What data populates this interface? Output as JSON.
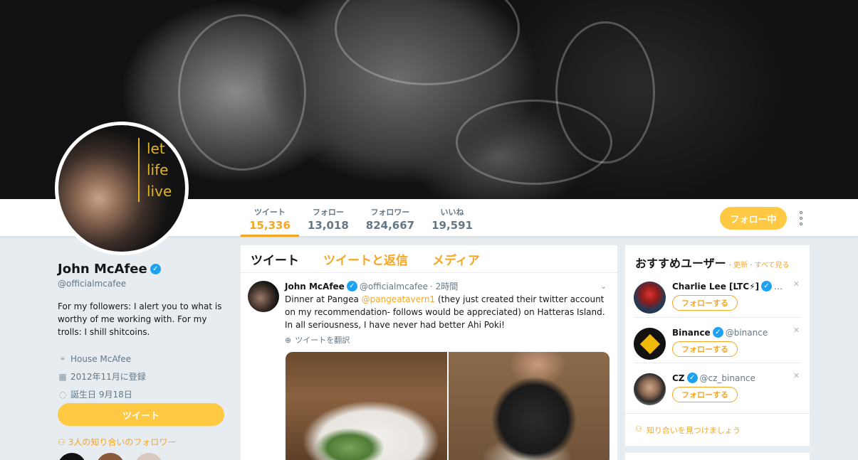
{
  "profile": {
    "name": "John McAfee",
    "handle": "@officialmcafee",
    "bio": "For my followers: I alert you to what is worthy of me working with. For my trolls: I shill shitcoins.",
    "location": "House McAfee",
    "joined": "2012年11月に登録",
    "birthday": "誕生日 9月18日",
    "avatar_text": [
      "let",
      "life",
      "live"
    ],
    "tweet_button": "ツイート",
    "followers_you_know": "3人の知り合いのフォロワー"
  },
  "nav": {
    "stats": [
      {
        "label": "ツイート",
        "value": "15,336"
      },
      {
        "label": "フォロー",
        "value": "13,018"
      },
      {
        "label": "フォロワー",
        "value": "824,667"
      },
      {
        "label": "いいね",
        "value": "19,591"
      }
    ],
    "follow_button": "フォロー中"
  },
  "timeline": {
    "tabs": [
      "ツイート",
      "ツイートと返信",
      "メディア"
    ],
    "tweet": {
      "name": "John McAfee",
      "handle": "@officialmcafee",
      "time": "· 2時間",
      "text_before": "Dinner at Pangea ",
      "mention": "@pangeatavern1",
      "text_after": " (they just created their twitter account on my recommendation- follows would be appreciated) on Hatteras Island. In all seriousness, I have never had better Ahi Poki!",
      "translate": "ツイートを翻訳"
    }
  },
  "who_to_follow": {
    "title": "おすすめユーザー",
    "refresh": "更新",
    "view_all": "すべて見る",
    "users": [
      {
        "name": "Charlie Lee [LTC⚡]",
        "handle": "…",
        "button": "フォローする"
      },
      {
        "name": "Binance",
        "handle": "@binance",
        "button": "フォローする"
      },
      {
        "name": "CZ",
        "handle": "@cz_binance",
        "button": "フォローする"
      }
    ],
    "find_friends": "知り合いを見つけましょう"
  },
  "colors": {
    "accent": "#f5a623",
    "button_fill": "#ffc943",
    "verified": "#1da1f2",
    "background": "#e6ecf0"
  }
}
